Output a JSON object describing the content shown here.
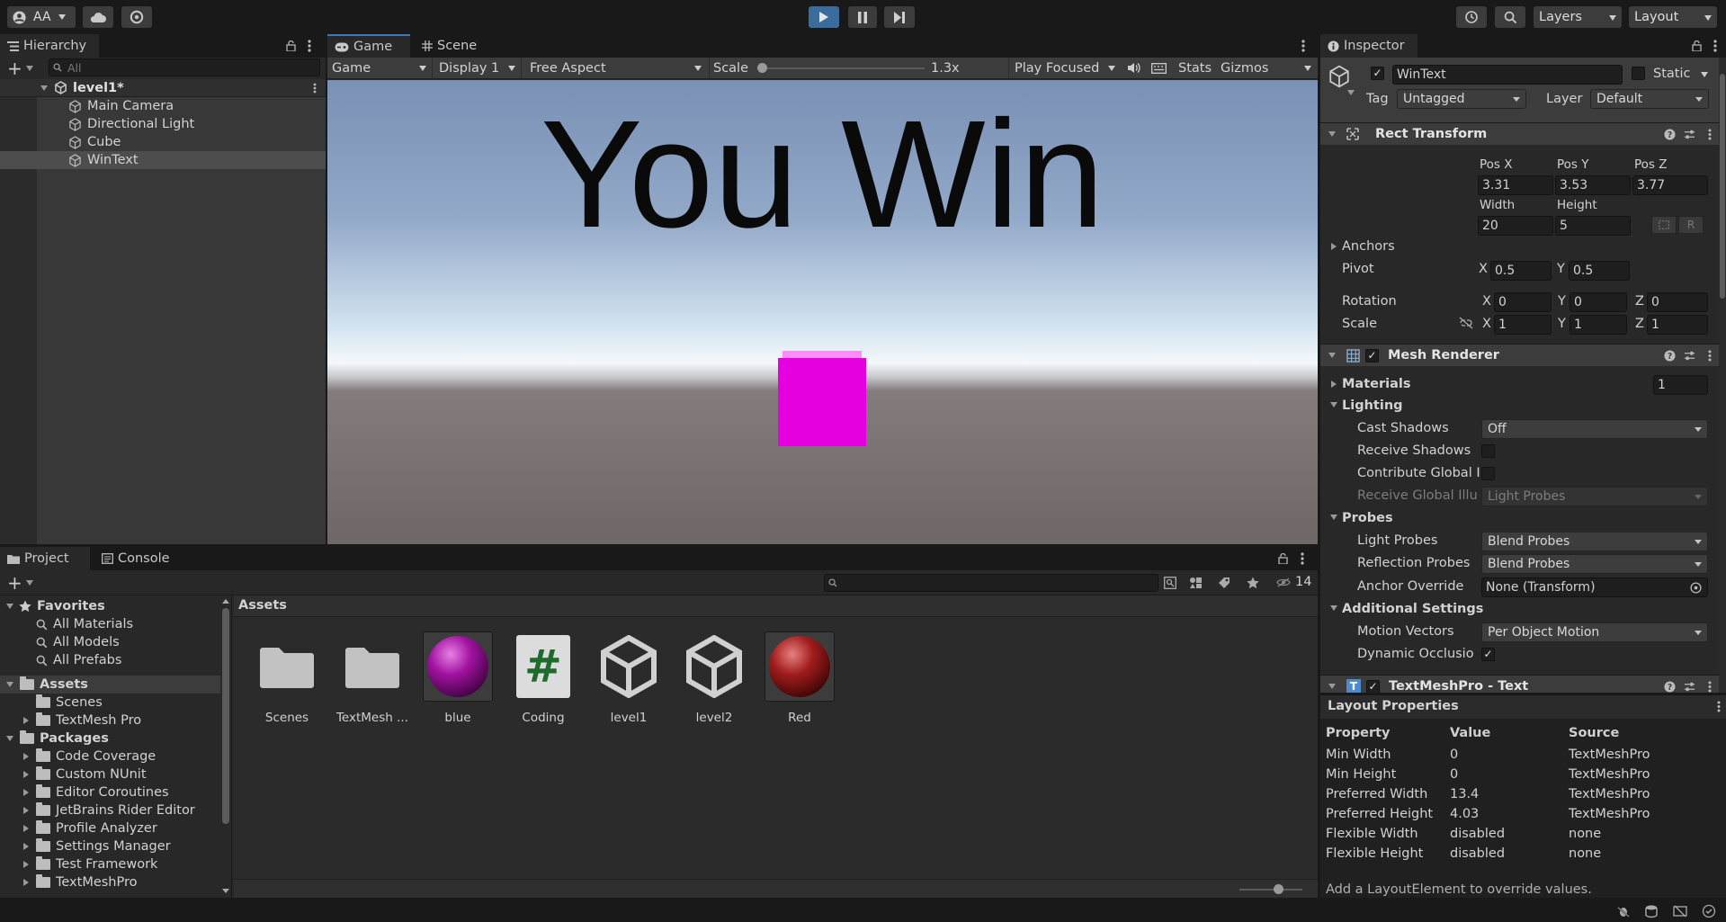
{
  "toolbar": {
    "account": "AA",
    "layers": "Layers",
    "layout": "Layout"
  },
  "hierarchy": {
    "tab": "Hierarchy",
    "search_placeholder": "All",
    "scene": "level1*",
    "items": [
      "Main Camera",
      "Directional Light",
      "Cube",
      "WinText"
    ]
  },
  "game_view": {
    "tabs": [
      "Game",
      "Scene"
    ],
    "mode": "Game",
    "display": "Display 1",
    "aspect": "Free Aspect",
    "scale_label": "Scale",
    "scale_value": "1.3x",
    "play_mode": "Play Focused",
    "stats": "Stats",
    "gizmos": "Gizmos",
    "win_text": "You Win",
    "cube_color": "#e600e0"
  },
  "inspector": {
    "tab": "Inspector",
    "object_name": "WinText",
    "static_label": "Static",
    "tag_label": "Tag",
    "tag_value": "Untagged",
    "layer_label": "Layer",
    "layer_value": "Default",
    "rect_transform": {
      "title": "Rect Transform",
      "pos_x_label": "Pos X",
      "pos_x": "3.31",
      "pos_y_label": "Pos Y",
      "pos_y": "3.53",
      "pos_z_label": "Pos Z",
      "pos_z": "3.77",
      "width_label": "Width",
      "width": "20",
      "height_label": "Height",
      "height": "5",
      "r_button": "R",
      "anchors": "Anchors",
      "pivot": "Pivot",
      "pivot_x": "0.5",
      "pivot_y": "0.5",
      "rotation": "Rotation",
      "rot_x": "0",
      "rot_y": "0",
      "rot_z": "0",
      "scale": "Scale",
      "scale_x": "1",
      "scale_y": "1",
      "scale_z": "1",
      "x": "X",
      "y": "Y",
      "z": "Z"
    },
    "mesh_renderer": {
      "title": "Mesh Renderer",
      "materials": "Materials",
      "materials_count": "1",
      "lighting": "Lighting",
      "cast_shadows": "Cast Shadows",
      "cast_shadows_value": "Off",
      "receive_shadows": "Receive Shadows",
      "contribute_gi": "Contribute Global I",
      "receive_gi": "Receive Global Illu",
      "receive_gi_value": "Light Probes",
      "probes": "Probes",
      "light_probes": "Light Probes",
      "light_probes_value": "Blend Probes",
      "reflection_probes": "Reflection Probes",
      "reflection_probes_value": "Blend Probes",
      "anchor_override": "Anchor Override",
      "anchor_override_value": "None (Transform)",
      "additional": "Additional Settings",
      "motion_vectors": "Motion Vectors",
      "motion_vectors_value": "Per Object Motion",
      "dynamic_occlusion": "Dynamic Occlusio"
    },
    "tmp_title": "TextMeshPro - Text"
  },
  "layout_properties": {
    "title": "Layout Properties",
    "headers": [
      "Property",
      "Value",
      "Source"
    ],
    "rows": [
      [
        "Min Width",
        "0",
        "TextMeshPro"
      ],
      [
        "Min Height",
        "0",
        "TextMeshPro"
      ],
      [
        "Preferred Width",
        "13.4",
        "TextMeshPro"
      ],
      [
        "Preferred Height",
        "4.03",
        "TextMeshPro"
      ],
      [
        "Flexible Width",
        "disabled",
        "none"
      ],
      [
        "Flexible Height",
        "disabled",
        "none"
      ]
    ],
    "footer": "Add a LayoutElement to override values."
  },
  "project": {
    "tabs": [
      "Project",
      "Console"
    ],
    "hidden_count": "14",
    "breadcrumb": "Assets",
    "favorites": "Favorites",
    "favorite_items": [
      "All Materials",
      "All Models",
      "All Prefabs"
    ],
    "assets_root": "Assets",
    "asset_folders": [
      "Scenes",
      "TextMesh Pro"
    ],
    "packages_root": "Packages",
    "packages": [
      "Code Coverage",
      "Custom NUnit",
      "Editor Coroutines",
      "JetBrains Rider Editor",
      "Profile Analyzer",
      "Settings Manager",
      "Test Framework",
      "TextMeshPro"
    ],
    "assets": [
      "Scenes",
      "TextMesh ...",
      "blue",
      "Coding",
      "level1",
      "level2",
      "Red"
    ],
    "coding_glyph": "#"
  }
}
